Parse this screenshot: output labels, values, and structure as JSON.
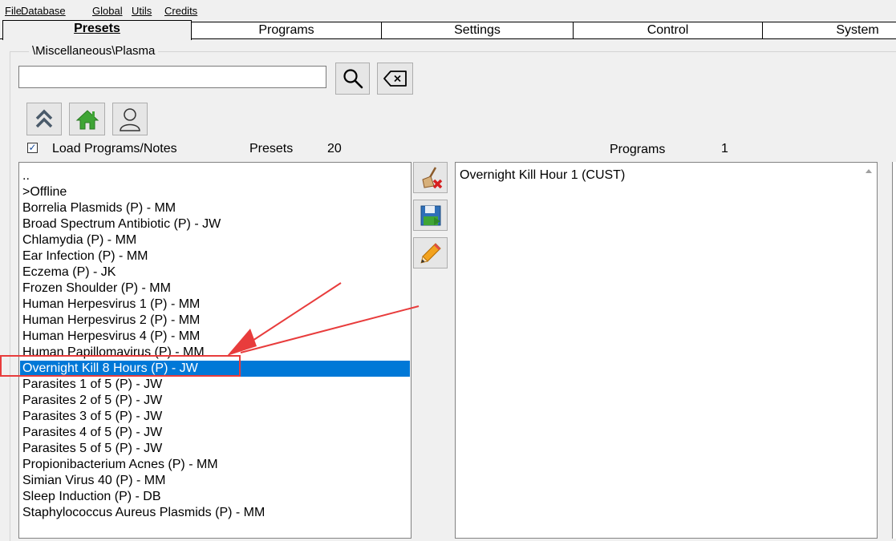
{
  "menu": [
    "File",
    "Database",
    "Global",
    "Utils",
    "Credits"
  ],
  "tabs": [
    "Presets",
    "Programs",
    "Settings",
    "Control",
    "System"
  ],
  "path": "\\Miscellaneous\\Plasma",
  "search": {
    "value": "",
    "placeholder": ""
  },
  "icons": {
    "search": "magnifier-icon",
    "clear": "backspace-clear-icon",
    "up": "double-chevron-up-icon",
    "home": "home-icon",
    "user": "user-icon",
    "delete": "broom-delete-icon",
    "save": "floppy-save-icon",
    "edit": "pencil-edit-icon"
  },
  "load_label": "Load Programs/Notes",
  "load_checked": true,
  "presets_label": "Presets",
  "presets_count": "20",
  "programs_label": "Programs",
  "programs_count": "1",
  "presets": [
    "..",
    ">Offline",
    "Borrelia Plasmids (P) - MM",
    "Broad Spectrum Antibiotic (P) - JW",
    "Chlamydia (P) - MM",
    "Ear Infection (P) - MM",
    "Eczema (P) - JK",
    "Frozen Shoulder (P) - MM",
    "Human Herpesvirus 1 (P) - MM",
    "Human Herpesvirus 2 (P) - MM",
    "Human Herpesvirus 4 (P) - MM",
    "Human Papillomavirus (P) - MM",
    "Overnight Kill 8 Hours (P) - JW",
    "Parasites 1 of 5 (P) - JW",
    "Parasites 2 of 5 (P) - JW",
    "Parasites 3 of 5 (P) - JW",
    "Parasites 4 of 5 (P) - JW",
    "Parasites 5 of 5 (P) - JW",
    "Propionibacterium Acnes (P) - MM",
    "Simian Virus 40 (P) - MM",
    "Sleep Induction (P) - DB",
    "Staphylococcus Aureus Plasmids (P) - MM"
  ],
  "selected_index": 12,
  "programs": [
    "Overnight Kill Hour 1 (CUST)"
  ],
  "colors": {
    "selection": "#0078d7",
    "annotation": "#e83c3c"
  }
}
